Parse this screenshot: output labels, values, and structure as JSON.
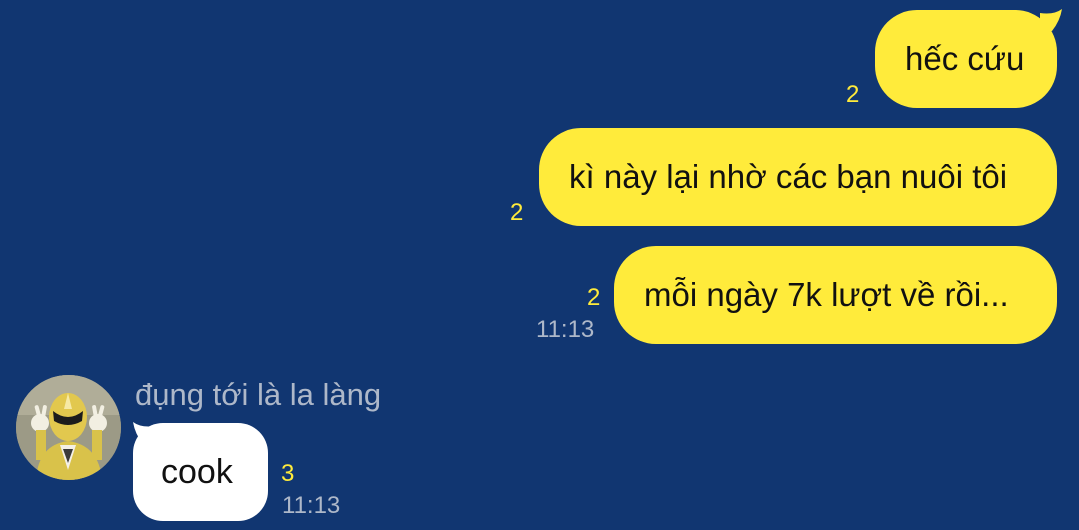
{
  "messages_out": [
    {
      "text": "hếc cứu",
      "unread": "2"
    },
    {
      "text": "kì này lại nhờ các bạn nuôi tôi",
      "unread": "2"
    },
    {
      "text": "mỗi ngày 7k lượt về rồi...",
      "unread": "2",
      "time": "11:13"
    }
  ],
  "message_in": {
    "sender": "đụng tới là la làng",
    "text": "cook",
    "unread": "3",
    "time": "11:13"
  },
  "icons": {
    "avatar": "yellow-ranger-avatar-icon"
  },
  "colors": {
    "background": "#113671",
    "bubble_out": "#ffeb3b",
    "bubble_in": "#ffffff",
    "unread_count": "#ffeb3b",
    "meta_text": "#aeb8c9"
  }
}
